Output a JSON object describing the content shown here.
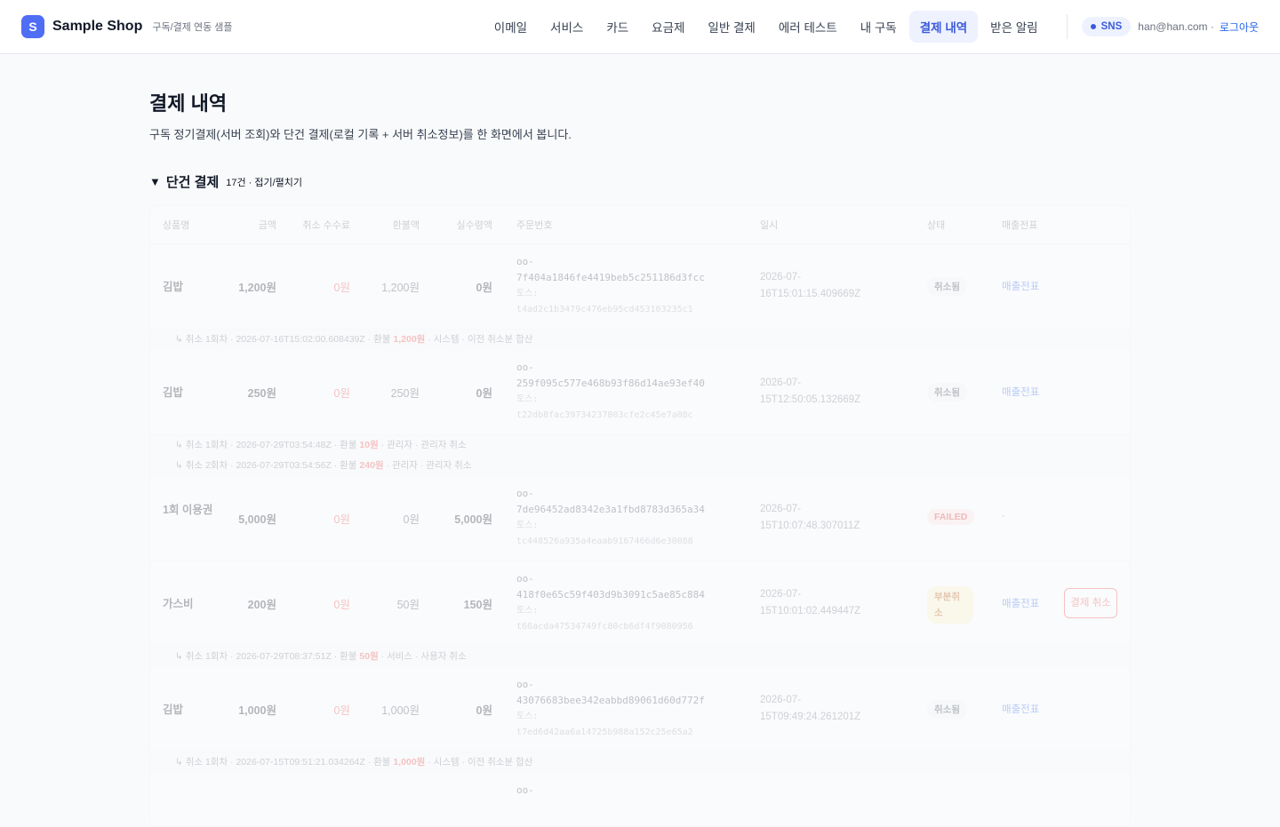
{
  "header": {
    "logo_letter": "S",
    "brand": "Sample Shop",
    "brand_sub": "구독/결제 연동 샘플",
    "nav": [
      "이메일",
      "서비스",
      "카드",
      "요금제",
      "일반 결제",
      "에러 테스트",
      "내 구독",
      "결제 내역",
      "받은 알림"
    ],
    "active_nav": "결제 내역",
    "sns_label": "SNS",
    "user_email": "han@han.com ·",
    "logout": "로그아웃"
  },
  "page": {
    "title": "결제 내역",
    "description": "구독 정기결제(서버 조회)와 단건 결제(로컬 기록 + 서버 취소정보)를 한 화면에서 봅니다."
  },
  "section": {
    "arrow": "▼",
    "title": "단건 결제",
    "meta": "17건 · 접기/펼치기"
  },
  "table": {
    "columns": [
      "상품명",
      "금액",
      "취소 수수료",
      "환불액",
      "실수령액",
      "주문번호",
      "일시",
      "상태",
      "매출전표"
    ],
    "rows": [
      {
        "name": "김밥",
        "amount": "1,200원",
        "fee": "0원",
        "refund": "1,200원",
        "actual": "0원",
        "order_prefix": "oo-",
        "order_id": "7f404a1846fe4419beb5c251186d3fcc",
        "toss_prefix": "토스:",
        "toss_id": "t4ad2c1b3479c476eb95cd453103235c1",
        "date_1": "2026-07-",
        "date_2": "16T15:01:15.409669Z",
        "status": "취소됨",
        "receipt": "매출전표",
        "notes": [
          {
            "pre": "↳ 취소 1회차 · 2026-07-16T15:02:00.608439Z · 환불 ",
            "amount": "1,200원",
            "post": " · 시스템 · 이전 취소분 합산"
          }
        ]
      },
      {
        "name": "김밥",
        "amount": "250원",
        "fee": "0원",
        "refund": "250원",
        "actual": "0원",
        "order_prefix": "oo-",
        "order_id": "259f095c577e468b93f86d14ae93ef40",
        "toss_prefix": "토스:",
        "toss_id": "t22db8fac39734237803cfe2c45e7a08c",
        "date_1": "2026-07-",
        "date_2": "15T12:50:05.132669Z",
        "status": "취소됨",
        "receipt": "매출전표",
        "notes": [
          {
            "pre": "↳ 취소 1회차 · 2026-07-29T03:54:48Z · 환불 ",
            "amount": "10원",
            "post": " · 관리자 · 관리자 취소"
          },
          {
            "pre": "↳ 취소 2회차 · 2026-07-29T03:54:56Z · 환불 ",
            "amount": "240원",
            "post": " · 관리자 · 관리자 취소"
          }
        ]
      },
      {
        "name": "1회 이용권",
        "amount": "5,000원",
        "fee": "0원",
        "refund": "0원",
        "actual": "5,000원",
        "order_prefix": "oo-",
        "order_id": "7de96452ad8342e3a1fbd8783d365a34",
        "toss_prefix": "토스:",
        "toss_id": "tc448526a935a4eaab9167466d6e30088",
        "date_1": "2026-07-",
        "date_2": "15T10:07:48.307011Z",
        "status": "FAILED",
        "receipt": "-",
        "notes": []
      },
      {
        "name": "가스비",
        "amount": "200원",
        "fee": "0원",
        "refund": "50원",
        "actual": "150원",
        "order_prefix": "oo-",
        "order_id": "418f0e65c59f403d9b3091c5ae85c884",
        "toss_prefix": "토스:",
        "toss_id": "t66acda47534749fc80cb6df4f9080956",
        "date_1": "2026-07-",
        "date_2": "15T10:01:02.449447Z",
        "status": "부분취소",
        "receipt": "매출전표",
        "cancel": "결제 취소",
        "notes": [
          {
            "pre": "↳ 취소 1회차 · 2026-07-29T08:37:51Z · 환불 ",
            "amount": "50원",
            "post": " · 서비스 · 사용자 취소"
          }
        ]
      },
      {
        "name": "김밥",
        "amount": "1,000원",
        "fee": "0원",
        "refund": "1,000원",
        "actual": "0원",
        "order_prefix": "oo-",
        "order_id": "43076683bee342eabbd89061d60d772f",
        "toss_prefix": "토스:",
        "toss_id": "t7ed6d42aa6a14725b988a152c25e65a2",
        "date_1": "2026-07-",
        "date_2": "15T09:49:24.261201Z",
        "status": "취소됨",
        "receipt": "매출전표",
        "notes": [
          {
            "pre": "↳ 취소 1회차 · 2026-07-15T09:51:21.034264Z · 환불 ",
            "amount": "1,000원",
            "post": " · 시스템 · 이전 취소분 합산"
          }
        ]
      }
    ],
    "trailing_order_prefix": "oo-"
  }
}
